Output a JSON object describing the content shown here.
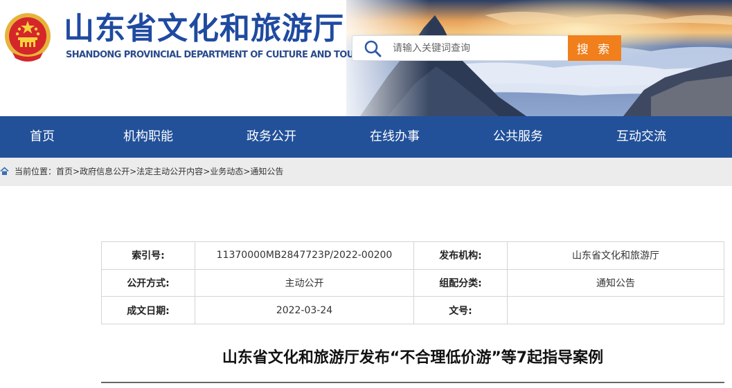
{
  "header": {
    "title": "山东省文化和旅游厅",
    "subtitle": "SHANDONG PROVINCIAL DEPARTMENT OF CULTURE AND TOURISM",
    "emblem_icon": "national-emblem-icon"
  },
  "search": {
    "placeholder": "请输入关键词查询",
    "button_label": "搜 索",
    "icon": "search-icon",
    "button_color": "#f07f1c"
  },
  "nav": {
    "color": "#22519a",
    "items": [
      "首页",
      "机构职能",
      "政务公开",
      "在线办事",
      "公共服务",
      "互动交流"
    ]
  },
  "breadcrumb": {
    "prefix": "当前位置：",
    "items": [
      "首页",
      "政府信息公开",
      "法定主动公开内容",
      "业务动态",
      "通知公告"
    ],
    "separator": ">"
  },
  "meta": {
    "index_label": "索引号:",
    "index_value": "11370000MB2847723P/2022-00200",
    "publisher_label": "发布机构:",
    "publisher_value": "山东省文化和旅游厅",
    "open_mode_label": "公开方式:",
    "open_mode_value": "主动公开",
    "category_label": "组配分类:",
    "category_value": "通知公告",
    "date_label": "成文日期:",
    "date_value": "2022-03-24",
    "doc_no_label": "文号:",
    "doc_no_value": ""
  },
  "article": {
    "title": "山东省文化和旅游厅发布“不合理低价游”等7起指导案例"
  }
}
